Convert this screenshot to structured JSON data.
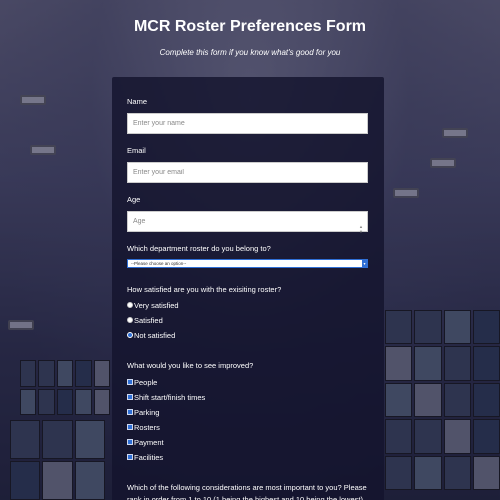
{
  "header": {
    "title": "MCR Roster Preferences Form",
    "subtitle": "Complete this form if you know what's good for you"
  },
  "form": {
    "name": {
      "label": "Name",
      "placeholder": "Enter your name"
    },
    "email": {
      "label": "Email",
      "placeholder": "Enter your email"
    },
    "age": {
      "label": "Age",
      "placeholder": "Age"
    },
    "department": {
      "label": "Which department roster do you belong to?",
      "selected": "--Please choose an option--"
    },
    "satisfaction": {
      "question": "How satisfied are you with the exisiting roster?",
      "options": [
        "Very satisfied",
        "Satisfied",
        "Not satisfied"
      ],
      "selected_index": 2
    },
    "improvements": {
      "question": "What would you like to see improved?",
      "options": [
        "People",
        "Shift start/finish times",
        "Parking",
        "Rosters",
        "Payment",
        "Facilities"
      ],
      "checked": [
        true,
        true,
        true,
        true,
        true,
        true
      ]
    },
    "ranking": {
      "question": "Which of the following considerations are most important to you? Please rank in order from 1 to 10 (1 being the highest and 10 being the lowest)"
    }
  },
  "colors": {
    "accent": "#2f6fd6",
    "form_bg": "#14142d"
  }
}
